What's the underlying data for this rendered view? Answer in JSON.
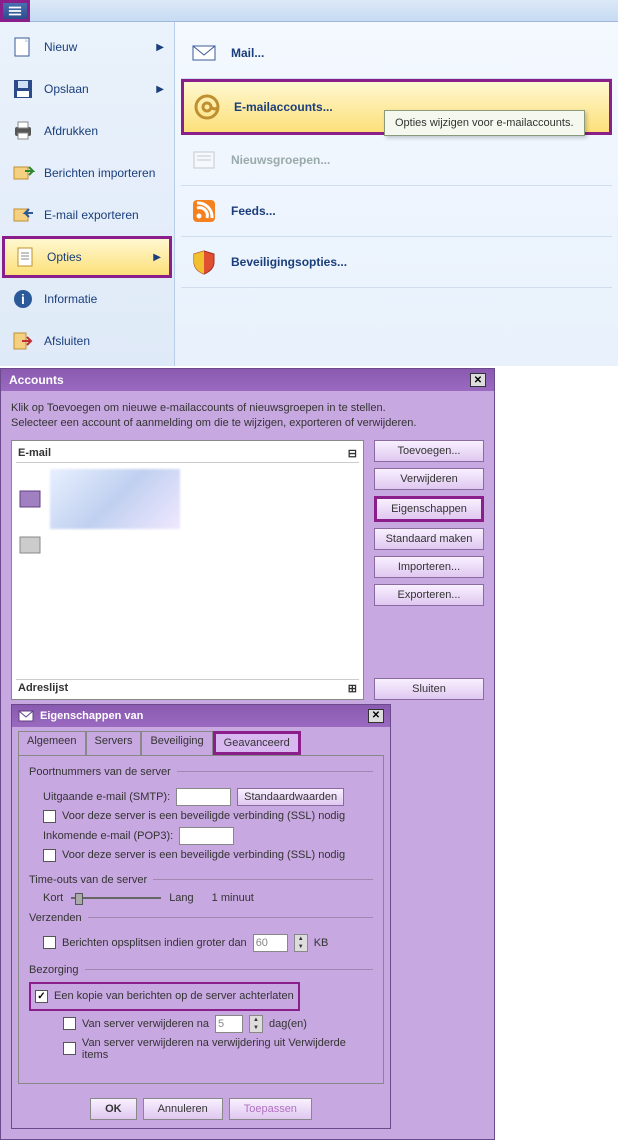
{
  "leftMenu": [
    {
      "label": "Nieuw",
      "hasArrow": true
    },
    {
      "label": "Opslaan",
      "hasArrow": true
    },
    {
      "label": "Afdrukken",
      "hasArrow": false
    },
    {
      "label": "Berichten importeren",
      "hasArrow": false
    },
    {
      "label": "E-mail exporteren",
      "hasArrow": false
    },
    {
      "label": "Opties",
      "hasArrow": true,
      "selected": true
    },
    {
      "label": "Informatie",
      "hasArrow": false
    },
    {
      "label": "Afsluiten",
      "hasArrow": false
    }
  ],
  "rightMenu": [
    {
      "label": "Mail..."
    },
    {
      "label": "E-mailaccounts...",
      "highlighted": true,
      "tooltip": "Opties wijzigen voor e-mailaccounts."
    },
    {
      "label": "Nieuwsgroepen...",
      "disabled": true
    },
    {
      "label": "Feeds..."
    },
    {
      "label": "Beveiligingsopties..."
    }
  ],
  "accounts": {
    "title": "Accounts",
    "intro1": "Klik op Toevoegen om nieuwe e-mailaccounts of nieuwsgroepen in te stellen.",
    "intro2": "Selecteer een account of aanmelding om die te wijzigen, exporteren of verwijderen.",
    "listHdr1": "E-mail",
    "listHdr2": "Adreslijst",
    "buttons": {
      "add": "Toevoegen...",
      "remove": "Verwijderen",
      "props": "Eigenschappen",
      "default": "Standaard maken",
      "import": "Importeren...",
      "export": "Exporteren...",
      "close": "Sluiten"
    }
  },
  "props": {
    "title": "Eigenschappen van",
    "tabs": {
      "algemeen": "Algemeen",
      "servers": "Servers",
      "beveiliging": "Beveiliging",
      "geavanceerd": "Geavanceerd"
    },
    "portGroup": "Poortnummers van de server",
    "smtpLabel": "Uitgaande e-mail (SMTP):",
    "stdBtn": "Standaardwaarden",
    "sslOut": "Voor deze server is een beveiligde verbinding (SSL) nodig",
    "pop3Label": "Inkomende e-mail (POP3):",
    "sslIn": "Voor deze server is een beveiligde verbinding (SSL) nodig",
    "timeoutGroup": "Time-outs van de server",
    "kort": "Kort",
    "lang": "Lang",
    "timeout": "1 minuut",
    "sendGroup": "Verzenden",
    "splitLabel": "Berichten opsplitsen indien groter dan",
    "splitVal": "60",
    "kb": "KB",
    "deliveryGroup": "Bezorging",
    "keepCopy": "Een kopie van berichten op de server achterlaten",
    "removeAfter": "Van server verwijderen na",
    "removeDays": "5",
    "dagen": "dag(en)",
    "removeDeleted": "Van server verwijderen na verwijdering uit Verwijderde items",
    "ok": "OK",
    "cancel": "Annuleren",
    "apply": "Toepassen"
  }
}
